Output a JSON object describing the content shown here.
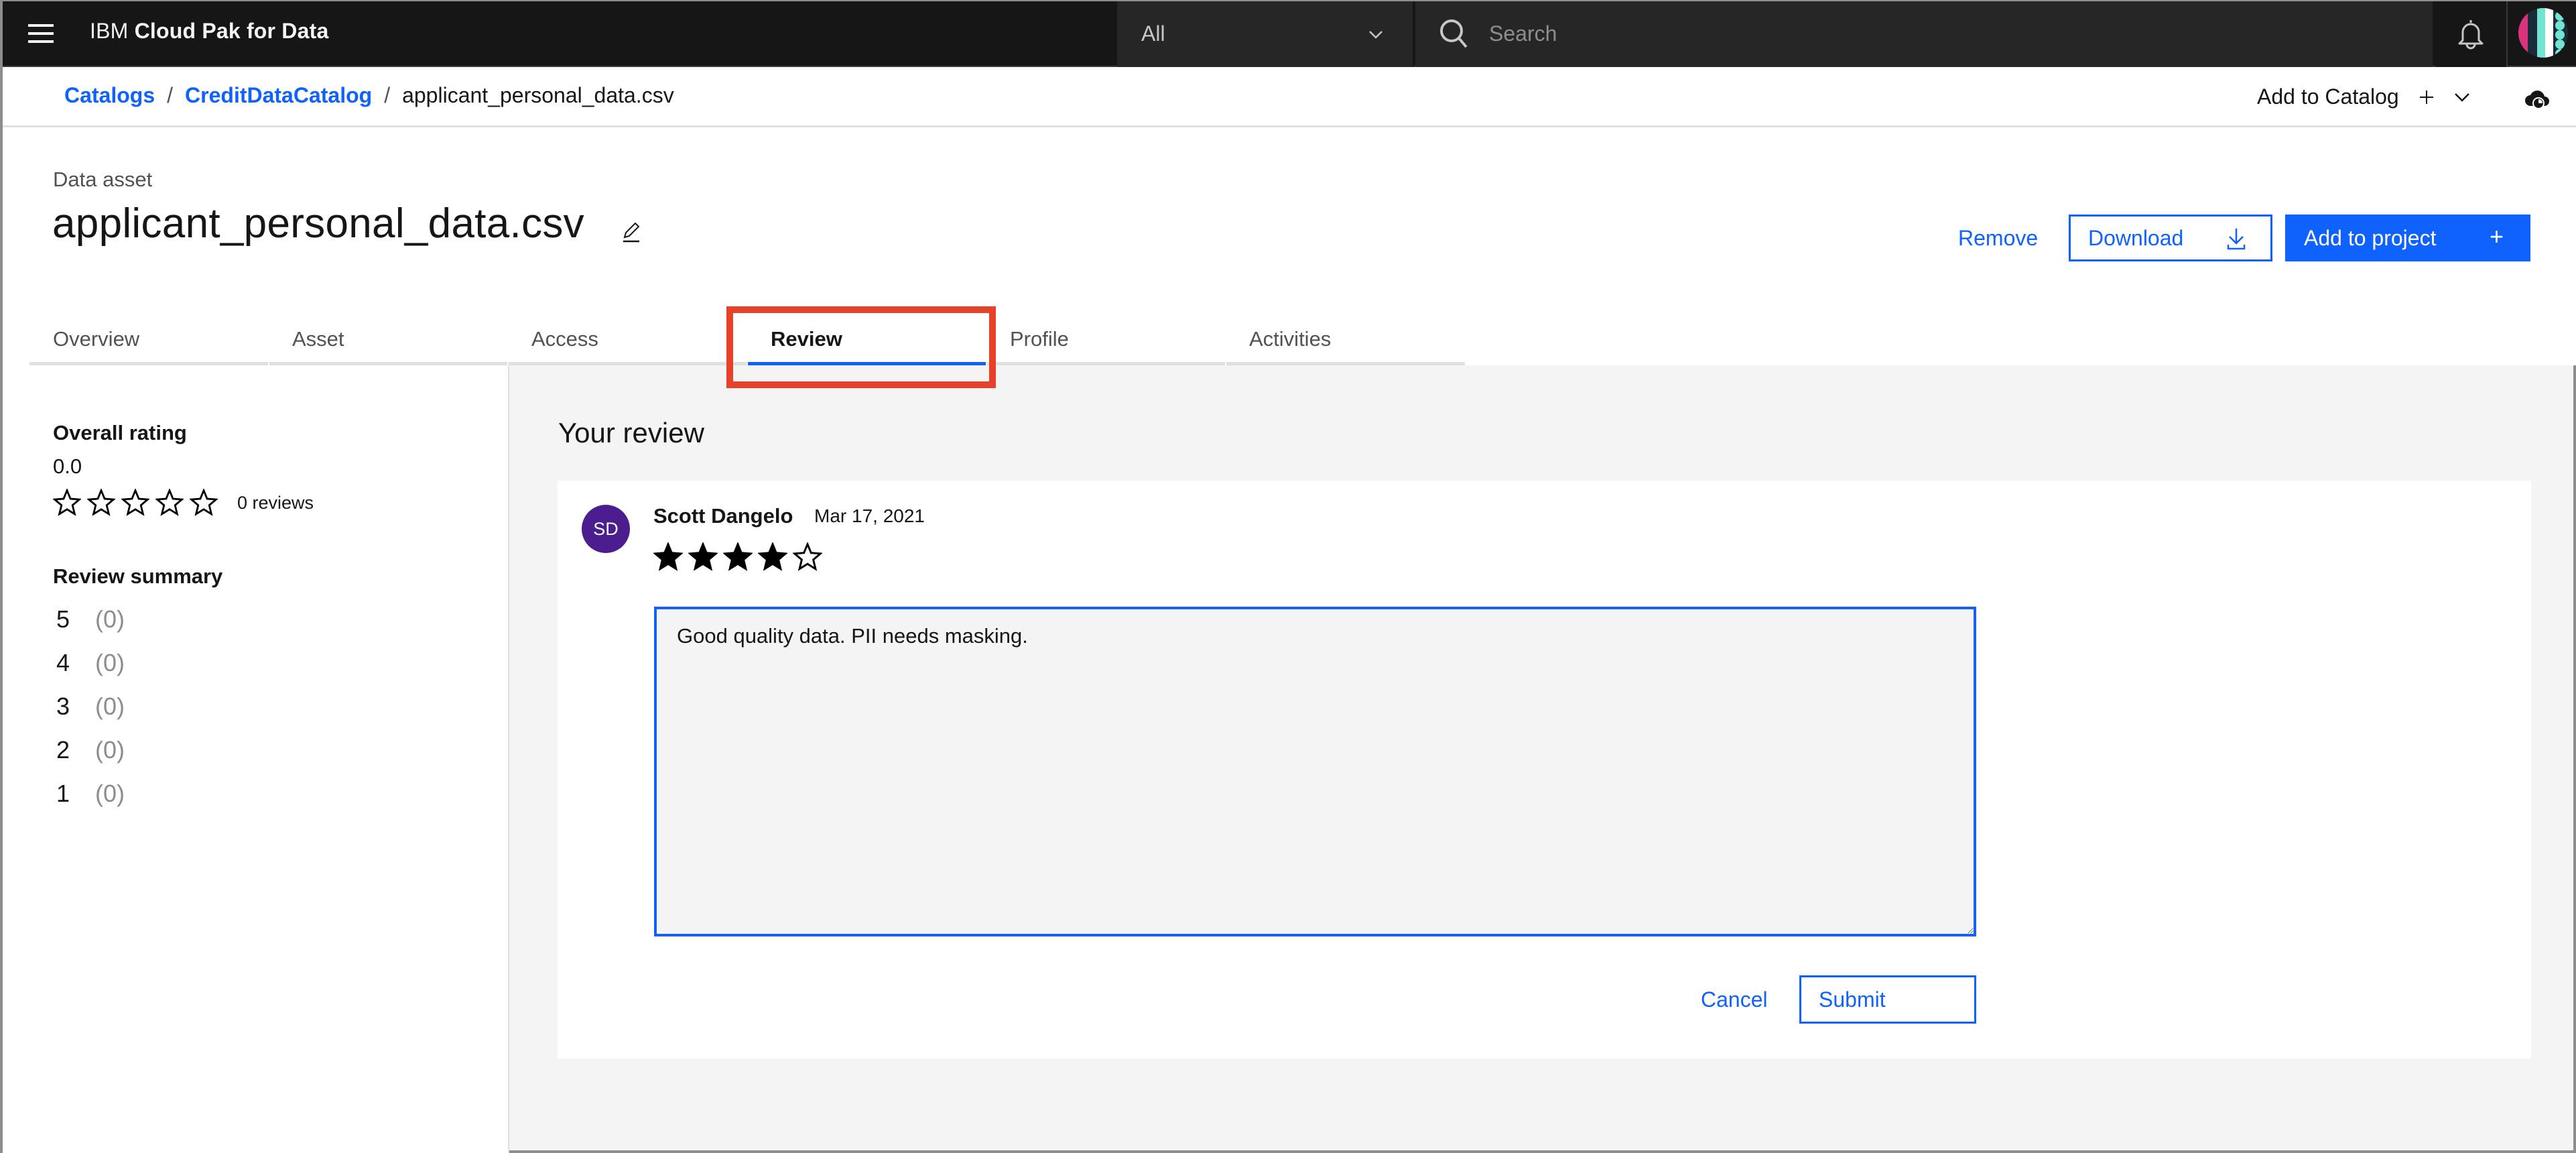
{
  "header": {
    "brand_prefix": "IBM",
    "brand_name": "Cloud Pak for Data",
    "scope_select": {
      "value": "All",
      "icon": "chevron-down-icon"
    },
    "search": {
      "placeholder": "Search",
      "value": "",
      "icon": "search-icon"
    },
    "notifications_icon": "bell-icon",
    "user_avatar": "user-avatar"
  },
  "breadcrumb": {
    "items": [
      "Catalogs",
      "CreditDataCatalog"
    ],
    "current": "applicant_personal_data.csv",
    "separator": "/"
  },
  "toolbar": {
    "add_to_catalog_label": "Add to Catalog",
    "add_icon": "plus-icon",
    "dropdown_icon": "chevron-down-icon",
    "sync_icon": "cloud-sync-icon"
  },
  "asset": {
    "type_label": "Data asset",
    "title": "applicant_personal_data.csv",
    "edit_icon": "pencil-icon"
  },
  "actions": {
    "remove_label": "Remove",
    "download_label": "Download",
    "add_to_project_label": "Add to project",
    "add_to_project_icon": "+"
  },
  "tabs": [
    {
      "label": "Overview",
      "active": false
    },
    {
      "label": "Asset",
      "active": false
    },
    {
      "label": "Access",
      "active": false
    },
    {
      "label": "Review",
      "active": true
    },
    {
      "label": "Profile",
      "active": false
    },
    {
      "label": "Activities",
      "active": false
    }
  ],
  "sidebar": {
    "overall_rating_heading": "Overall rating",
    "overall_rating_value": "0.0",
    "overall_stars_filled": 0,
    "stars_total": 5,
    "reviews_count_label": "0 reviews",
    "review_summary_heading": "Review summary",
    "summary": [
      {
        "stars": "5",
        "count": "(0)"
      },
      {
        "stars": "4",
        "count": "(0)"
      },
      {
        "stars": "3",
        "count": "(0)"
      },
      {
        "stars": "2",
        "count": "(0)"
      },
      {
        "stars": "1",
        "count": "(0)"
      }
    ]
  },
  "review": {
    "section_title": "Your review",
    "author_initials": "SD",
    "author_name": "Scott Dangelo",
    "date": "Mar 17, 2021",
    "rating": 4,
    "rating_max": 5,
    "text": "Good quality data. PII needs masking.",
    "cancel_label": "Cancel",
    "submit_label": "Submit"
  },
  "colors": {
    "accent": "#0f62fe",
    "header_bg": "#161616",
    "avatar_bg": "#4b1d8e",
    "highlight": "#e8412a",
    "page_bg": "#f4f4f4"
  }
}
